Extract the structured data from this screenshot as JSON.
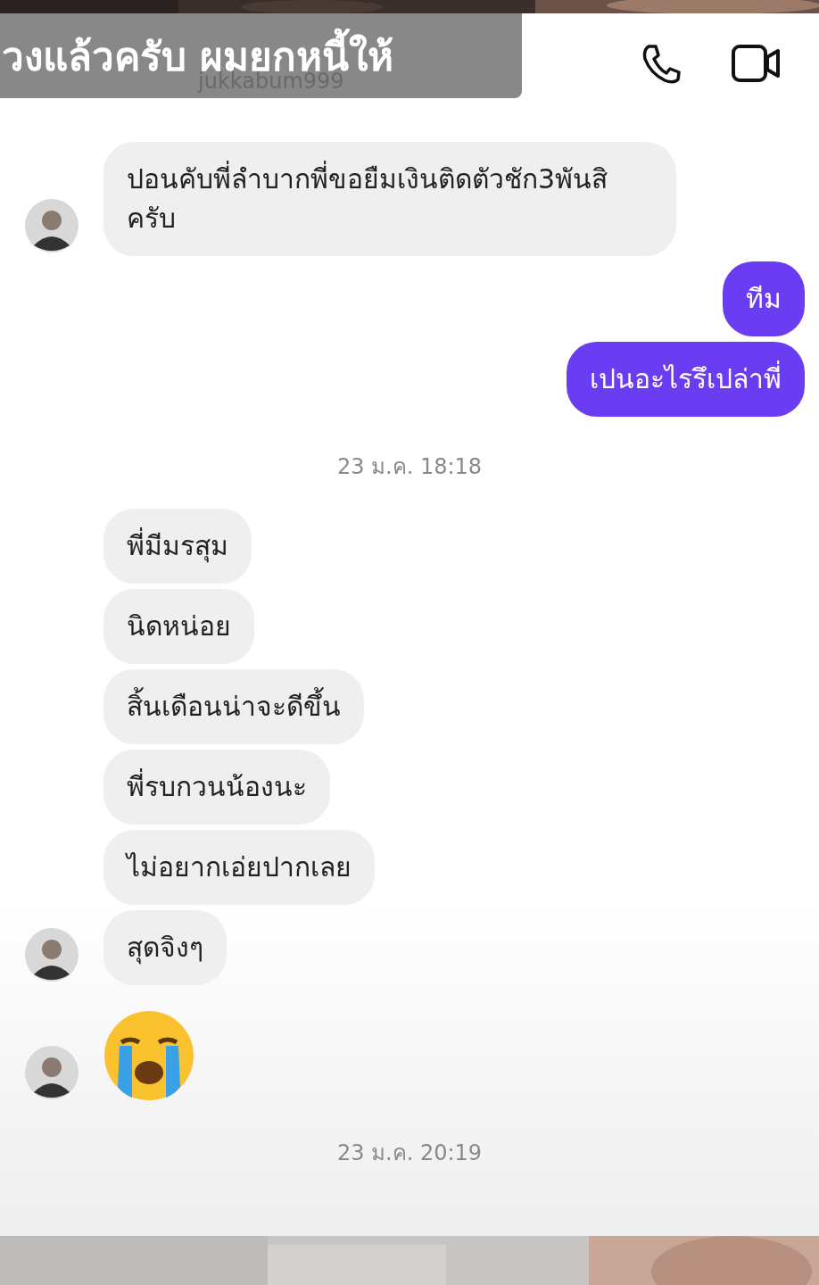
{
  "header": {
    "username": "jukkabum999",
    "caption": "วงแล้วครับ ผมยกหนี้ให้"
  },
  "messages": [
    {
      "kind": "received",
      "text": "ปอนคับพี่ลำบากพี่ขอยืมเงินติดตัวชัก3พันสิครับ",
      "avatar": true
    },
    {
      "kind": "sent",
      "text": "ทีม"
    },
    {
      "kind": "sent",
      "text": "เปนอะไรรึเปล่าพี่"
    },
    {
      "kind": "timestamp",
      "text": "23 ม.ค. 18:18"
    },
    {
      "kind": "received",
      "text": "พี่มีมรสุม",
      "avatar": false
    },
    {
      "kind": "received",
      "text": "นิดหน่อย",
      "avatar": false
    },
    {
      "kind": "received",
      "text": "สิ้นเดือนน่าจะดีขึ้น",
      "avatar": false
    },
    {
      "kind": "received",
      "text": "พี่รบกวนน้องนะ",
      "avatar": false
    },
    {
      "kind": "received",
      "text": "ไม่อยากเอ่ยปากเลย",
      "avatar": false
    },
    {
      "kind": "received",
      "text": "สุดจิงๆ",
      "avatar": true
    },
    {
      "kind": "emoji",
      "avatar": true
    },
    {
      "kind": "timestamp",
      "text": "23 ม.ค. 20:19"
    }
  ]
}
